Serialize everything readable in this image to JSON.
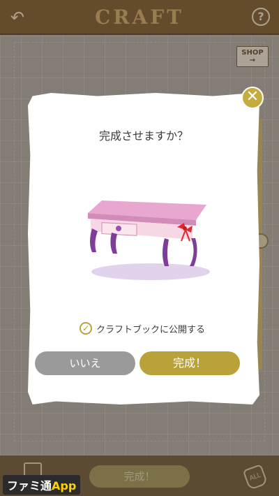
{
  "header": {
    "title": "CRAFT",
    "back_icon": "back-arrow-icon",
    "help_label": "?"
  },
  "shop": {
    "label": "SHOP",
    "arrow": "→"
  },
  "dialog": {
    "question": "完成させますか？",
    "illustration": "pink-table-with-ribbon",
    "checkbox": {
      "checked": true,
      "mark": "✓",
      "label": "クラフトブックに公開する"
    },
    "buttons": {
      "no": "いいえ",
      "yes": "完成！"
    },
    "close": "✕"
  },
  "bottom": {
    "complete_label": "完成！",
    "all_label": "ALL"
  },
  "watermark": {
    "brand": "ファミ通",
    "app": "App"
  },
  "colors": {
    "accent": "#b9a23a",
    "gray_button": "#9a9a9a",
    "header": "#7a5a2e"
  }
}
